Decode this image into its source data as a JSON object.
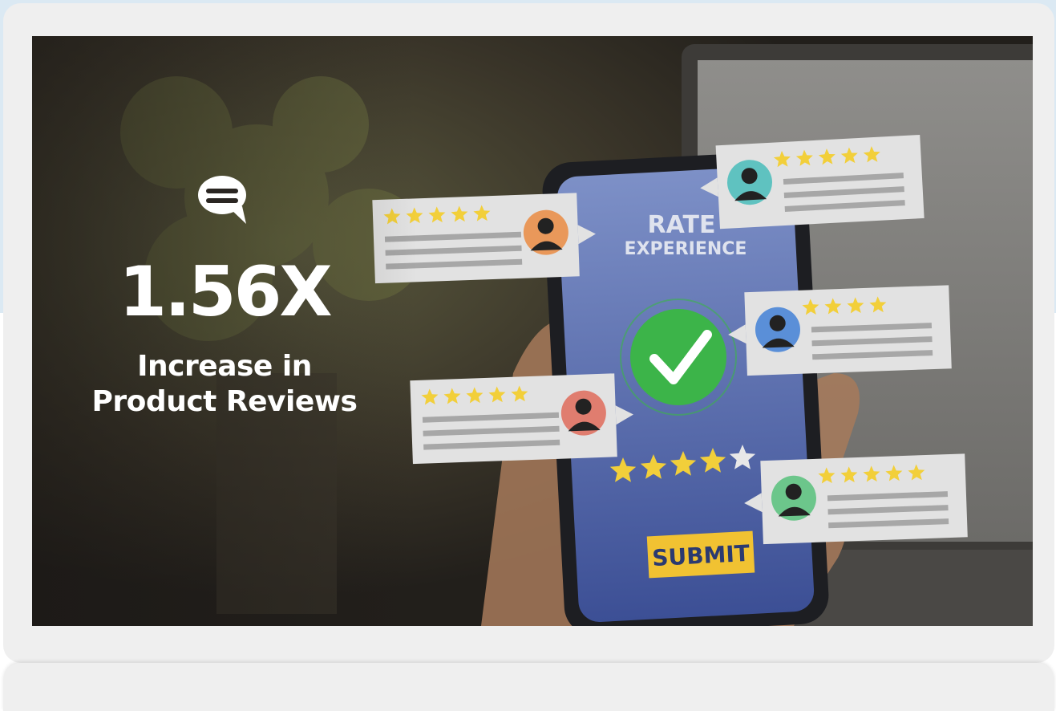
{
  "stat": {
    "icon": "chat-bubble-icon",
    "value": "1.56X",
    "label_line1": "Increase in",
    "label_line2": "Product Reviews"
  },
  "phone": {
    "title_line1": "RATE",
    "title_line2": "EXPERIENCE",
    "submit_label": "SUBMIT",
    "rating_stars": 4,
    "rating_max": 5
  },
  "reviews": [
    {
      "stars": 5,
      "avatar_color": "#e9985a"
    },
    {
      "stars": 5,
      "avatar_color": "#5fc2c0"
    },
    {
      "stars": 4,
      "avatar_color": "#5a8fd8"
    },
    {
      "stars": 5,
      "avatar_color": "#e07d6f"
    },
    {
      "stars": 5,
      "avatar_color": "#6cc68b"
    }
  ],
  "colors": {
    "star": "#f2cf3a",
    "check": "#3cb449",
    "submit_bg": "#f1c232",
    "phone_screen": "#5e72b0"
  }
}
